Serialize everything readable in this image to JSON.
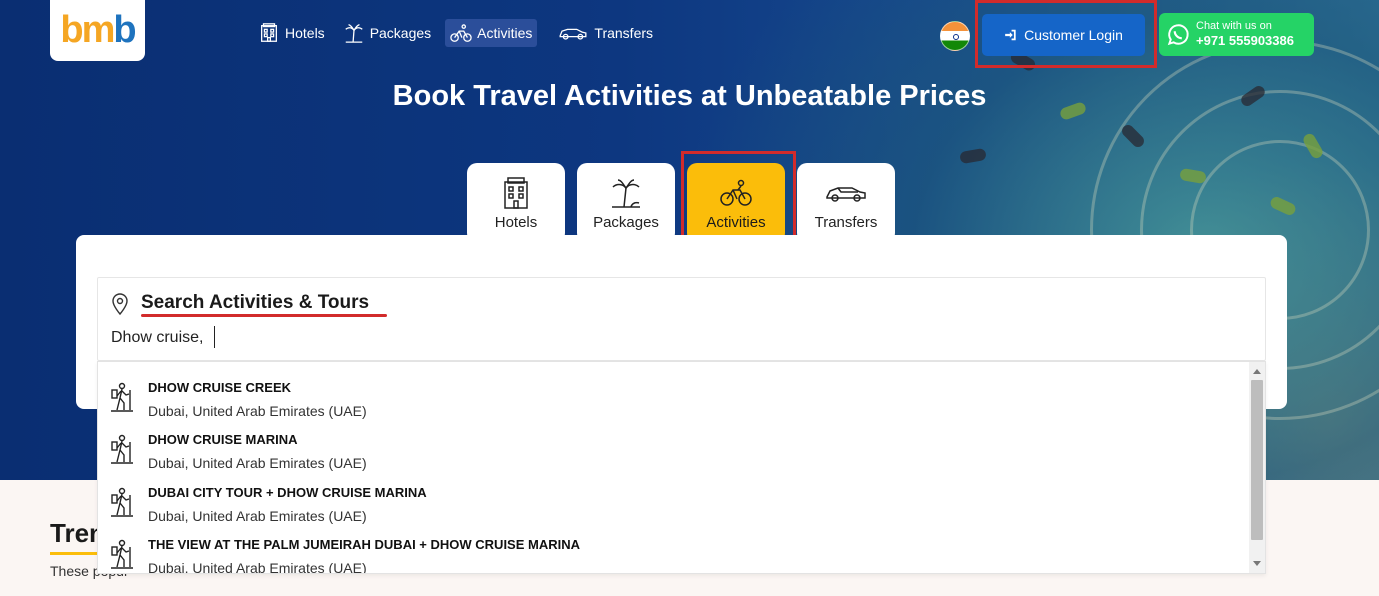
{
  "brand": {
    "logo_part1": "bm",
    "logo_part2": "b"
  },
  "topnav": [
    {
      "label": "Hotels",
      "icon": "hotel-icon",
      "active": false
    },
    {
      "label": "Packages",
      "icon": "palm-tree-icon",
      "active": false
    },
    {
      "label": "Activities",
      "icon": "cyclist-icon",
      "active": true
    },
    {
      "label": "Transfers",
      "icon": "car-icon",
      "active": false
    }
  ],
  "header": {
    "flag": "india-flag-icon",
    "login_label": "Customer Login",
    "whatsapp_line1": "Chat with us on",
    "whatsapp_line2": "+971 555903386"
  },
  "hero": {
    "headline": "Book Travel Activities at Unbeatable Prices"
  },
  "tabs": [
    {
      "label": "Hotels",
      "icon": "hotel-icon",
      "active": false
    },
    {
      "label": "Packages",
      "icon": "palm-tree-icon",
      "active": false
    },
    {
      "label": "Activities",
      "icon": "cyclist-icon",
      "active": true
    },
    {
      "label": "Transfers",
      "icon": "car-icon",
      "active": false
    }
  ],
  "search": {
    "label": "Search Activities & Tours",
    "value": "Dhow cruise,"
  },
  "results": [
    {
      "title": "DHOW CRUISE CREEK",
      "location": "Dubai, United Arab Emirates (UAE)"
    },
    {
      "title": "DHOW CRUISE MARINA",
      "location": "Dubai, United Arab Emirates (UAE)"
    },
    {
      "title": "DUBAI CITY TOUR + DHOW CRUISE MARINA",
      "location": "Dubai, United Arab Emirates (UAE)"
    },
    {
      "title": "THE VIEW AT THE PALM JUMEIRAH DUBAI + DHOW CRUISE MARINA",
      "location": "Dubai, United Arab Emirates (UAE)"
    }
  ],
  "trending": {
    "title": "Tren",
    "subtitle": "These popul"
  },
  "colors": {
    "brand_blue": "#1565c8",
    "accent_yellow": "#fbbd0a",
    "highlight_red": "#d22b2b",
    "whatsapp_green": "#25d366"
  }
}
